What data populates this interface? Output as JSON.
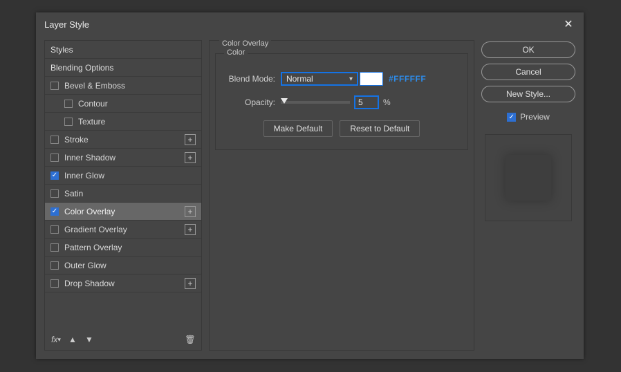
{
  "dialog": {
    "title": "Layer Style"
  },
  "sidebar": {
    "styles_label": "Styles",
    "blending_label": "Blending Options",
    "items": [
      {
        "label": "Bevel & Emboss",
        "checked": false,
        "plus": false,
        "indent": false
      },
      {
        "label": "Contour",
        "checked": false,
        "plus": false,
        "indent": true
      },
      {
        "label": "Texture",
        "checked": false,
        "plus": false,
        "indent": true
      },
      {
        "label": "Stroke",
        "checked": false,
        "plus": true,
        "indent": false
      },
      {
        "label": "Inner Shadow",
        "checked": false,
        "plus": true,
        "indent": false
      },
      {
        "label": "Inner Glow",
        "checked": true,
        "plus": false,
        "indent": false
      },
      {
        "label": "Satin",
        "checked": false,
        "plus": false,
        "indent": false
      },
      {
        "label": "Color Overlay",
        "checked": true,
        "plus": true,
        "indent": false,
        "selected": true
      },
      {
        "label": "Gradient Overlay",
        "checked": false,
        "plus": true,
        "indent": false
      },
      {
        "label": "Pattern Overlay",
        "checked": false,
        "plus": false,
        "indent": false
      },
      {
        "label": "Outer Glow",
        "checked": false,
        "plus": false,
        "indent": false
      },
      {
        "label": "Drop Shadow",
        "checked": false,
        "plus": true,
        "indent": false
      }
    ]
  },
  "center": {
    "group_title": "Color Overlay",
    "color_title": "Color",
    "blend_mode_label": "Blend Mode:",
    "blend_mode_value": "Normal",
    "swatch_hex": "#FFFFFF",
    "hex_display": "#FFFFFF",
    "opacity_label": "Opacity:",
    "opacity_value": "5",
    "opacity_unit": "%",
    "make_default": "Make Default",
    "reset_default": "Reset to Default"
  },
  "right": {
    "ok": "OK",
    "cancel": "Cancel",
    "new_style": "New Style...",
    "preview_label": "Preview"
  }
}
